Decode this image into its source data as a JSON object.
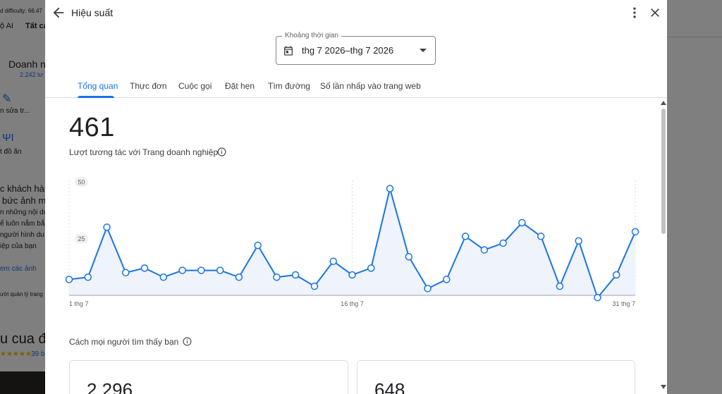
{
  "background": {
    "difficulty_text": "d difficulty: 66.47",
    "tab_ai": "ộ AI",
    "tab_all": "Tất cả",
    "business_name": "Doanh n",
    "reviews_count": "2.242 lư",
    "edit_label": "n sửa tr...",
    "food_label": "t đồ ăn",
    "customers_line1": "c khách hàn",
    "customers_line2": "bức ảnh m",
    "desc_line1": "n những nội du",
    "desc_line2": "ể luôn nắm bắ",
    "desc_line3": "người hình du",
    "desc_line4": "iệp của bạn",
    "view_photos": "em các ảnh",
    "manage_label": "ười quản lý trang",
    "heading_bottom": "u cua đ",
    "stars": "★★★★★",
    "stars_count": "39 b"
  },
  "dialog": {
    "title": "Hiệu suất",
    "date_range": {
      "label": "Khoảng thời gian",
      "value": "thg 7 2026–thg 7 2026"
    },
    "tabs": [
      {
        "label": "Tổng quan",
        "active": true
      },
      {
        "label": "Thực đơn",
        "active": false
      },
      {
        "label": "Cuộc gọi",
        "active": false
      },
      {
        "label": "Đặt hẹn",
        "active": false
      },
      {
        "label": "Tìm đường",
        "active": false
      },
      {
        "label": "Số lần nhấp vào trang web",
        "active": false
      }
    ],
    "total_value": "461",
    "total_label": "Lượt tương tác với Trang doanh nghiệp",
    "section_label": "Cách mọi người tìm thấy bạn",
    "cards": [
      {
        "value": "2.296"
      },
      {
        "value": "648"
      }
    ]
  },
  "colors": {
    "accent": "#1a73e8",
    "area_fill": "#eef3fc"
  },
  "chart_data": {
    "type": "line",
    "x": [
      1,
      2,
      3,
      4,
      5,
      6,
      7,
      8,
      9,
      10,
      11,
      12,
      13,
      14,
      15,
      16,
      17,
      18,
      19,
      20,
      21,
      22,
      23,
      24,
      25,
      26,
      27,
      28,
      29,
      30,
      31
    ],
    "values": [
      7,
      8,
      30,
      10,
      12,
      8,
      11,
      11,
      11,
      8,
      22,
      8,
      9,
      4,
      15,
      9,
      12,
      47,
      17,
      3,
      7,
      26,
      20,
      23,
      32,
      26,
      4,
      24,
      -1,
      9,
      28
    ],
    "y_ticks": [
      "25",
      "50"
    ],
    "x_tick_labels": [
      "1 thg 7",
      "16 thg 7",
      "31 thg 7"
    ],
    "ylim": [
      0,
      50
    ]
  }
}
